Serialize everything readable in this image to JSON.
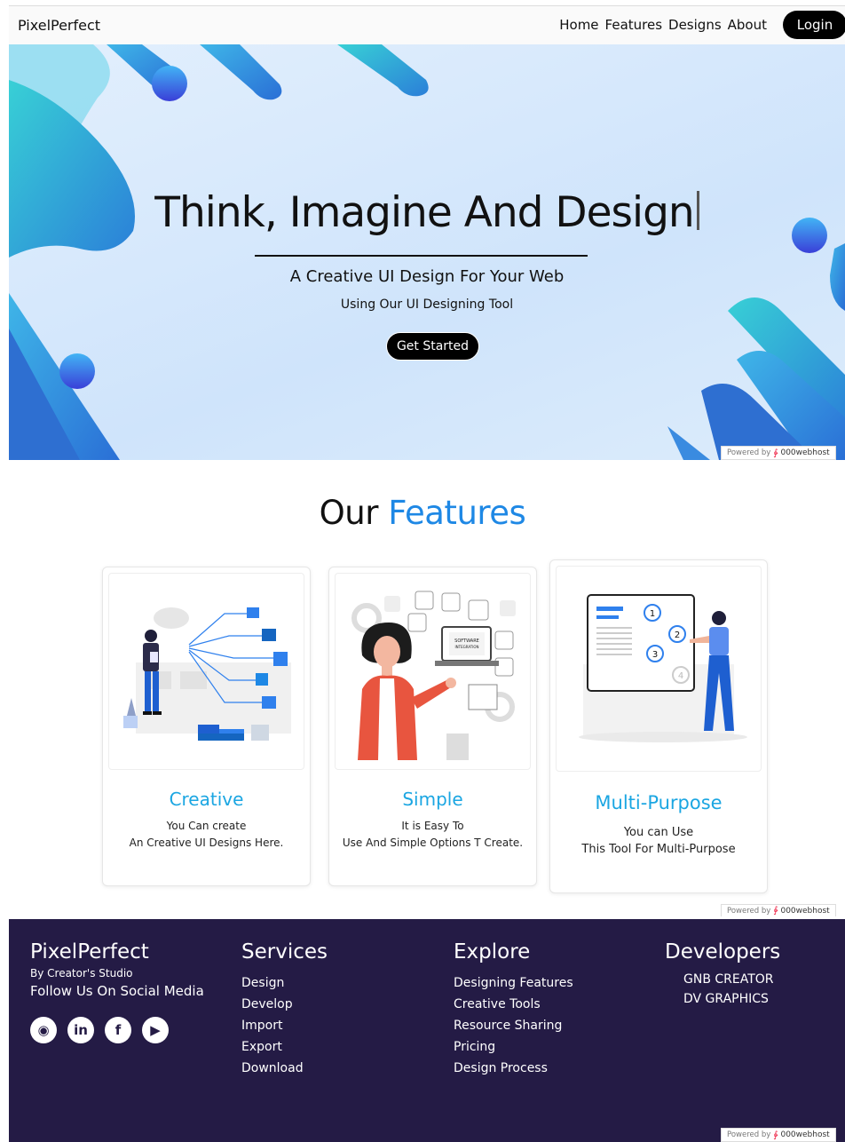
{
  "header": {
    "brand": "PixelPerfect",
    "nav": [
      "Home",
      "Features",
      "Designs",
      "About"
    ],
    "login_label": "Login"
  },
  "hero": {
    "title": "Think, Imagine And Design",
    "subtitle": "A Creative UI Design For Your Web",
    "subtitle2": "Using Our UI Designing Tool",
    "cta_label": "Get Started"
  },
  "powered": {
    "prefix": "Powered by",
    "host": "000webhost"
  },
  "features": {
    "title_plain": "Our",
    "title_accent": "Features",
    "cards": [
      {
        "title": "Creative",
        "line1": "You Can create",
        "line2": "An Creative UI Designs Here."
      },
      {
        "title": "Simple",
        "line1": "It is Easy To",
        "line2": "Use And Simple Options T Create."
      },
      {
        "title": "Multi-Purpose",
        "line1": "You can Use",
        "line2": "This Tool For Multi-Purpose"
      }
    ],
    "card2_screen_label": "SOFTWARE",
    "card2_screen_label2": "INTEGRATION"
  },
  "footer": {
    "brand": "PixelPerfect",
    "byline": "By Creator's Studio",
    "follow": "Follow Us On Social Media",
    "social_icons": [
      "instagram-icon",
      "linkedin-icon",
      "facebook-icon",
      "youtube-icon"
    ],
    "services": {
      "heading": "Services",
      "links": [
        "Design",
        "Develop",
        "Import",
        "Export",
        "Download"
      ]
    },
    "explore": {
      "heading": "Explore",
      "links": [
        "Designing Features",
        "Creative Tools",
        "Resource Sharing",
        "Pricing",
        "Design Process"
      ]
    },
    "developers": {
      "heading": "Developers",
      "links": [
        "GNB CREATOR",
        "DV GRAPHICS"
      ]
    }
  },
  "colors": {
    "accent": "#1e88e5",
    "card_title": "#1ba6e2",
    "footer_bg": "#241b45",
    "button_bg": "#000000"
  }
}
